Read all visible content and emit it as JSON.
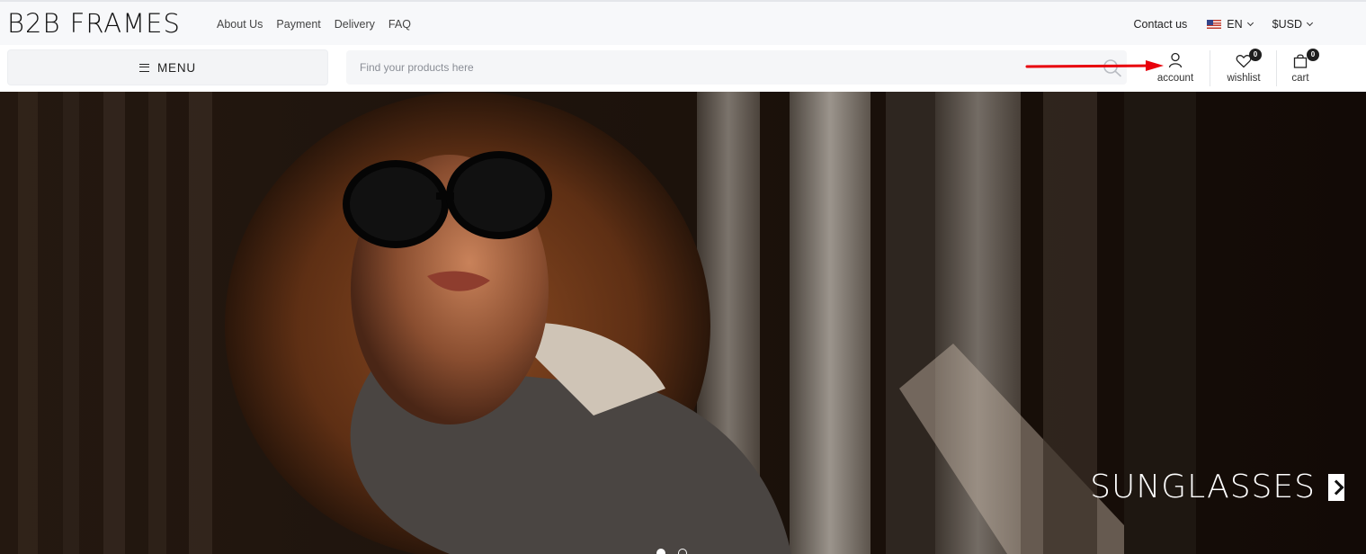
{
  "header": {
    "logo": "B2B FRAMES",
    "nav": [
      "About Us",
      "Payment",
      "Delivery",
      "FAQ"
    ],
    "contact": "Contact us",
    "language": "EN",
    "currency": "$USD"
  },
  "toolbar": {
    "menu_label": "MENU",
    "search_placeholder": "Find your products here",
    "account_label": "account",
    "wishlist_label": "wishlist",
    "wishlist_count": "0",
    "cart_label": "cart",
    "cart_count": "0"
  },
  "hero": {
    "title": "SUNGLASSES",
    "slide_count": 2,
    "active_slide": 1
  },
  "colors": {
    "annotation_arrow": "#e8000b",
    "badge": "#1e1e1e",
    "topbar_bg": "#f7f8fa"
  }
}
